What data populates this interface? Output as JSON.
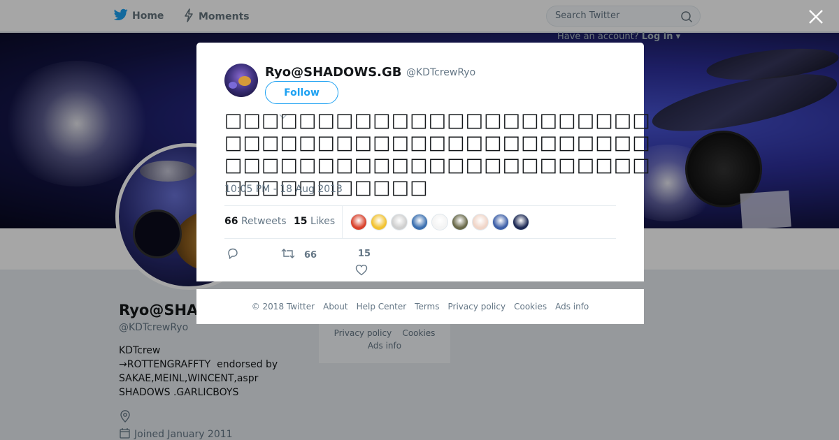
{
  "nav": {
    "home_label": "Home",
    "moments_label": "Moments",
    "search_placeholder": "Search Twitter",
    "have_account": "Have an account?",
    "login_label": "Log in"
  },
  "profile": {
    "name": "Ryo@SHA",
    "handle": "@KDTcrewRyo",
    "bio_lines": [
      "KDTcrew",
      "→ROTTENGRAFFTY  endorsed by",
      "SAKAE,MEINL,WINCENT,aspr",
      "SHADOWS .GARLICBOYS"
    ],
    "joined": "Joined January 2011"
  },
  "side_footer": {
    "row1": [
      "Privacy policy",
      "Cookies"
    ],
    "row2": "Ads info"
  },
  "tweet": {
    "author_name": "Ryo@SHADOWS.GB",
    "author_handle": "@KDTcrewRyo",
    "follow_label": "Follow",
    "text": "□□□□□□□□□□□□□□□□□□□□□□□□□□□□□□□□□□□□□□□□□□□□□□□□□□□□□□□□□□□□□□□□□□□□□□□□□□□□□□□□",
    "timestamp": "10:05 PM - 18 Aug 2013",
    "retweets_count": "66",
    "retweets_label": "Retweets",
    "likes_count": "15",
    "likes_label": "Likes",
    "action_retweet_count": "66",
    "action_like_count": "15",
    "liker_colors": [
      "#d9412b",
      "#f2c230",
      "#cfcfcf",
      "#3a6fb0",
      "#f4f4f4",
      "#6a6a4a",
      "#f0d5c8",
      "#3d5fa8",
      "#1e2a55"
    ]
  },
  "footer": {
    "copyright": "© 2018 Twitter",
    "about": "About",
    "help": "Help Center",
    "terms": "Terms",
    "privacy": "Privacy policy",
    "cookies": "Cookies",
    "ads": "Ads info"
  },
  "colors": {
    "accent": "#1da1f2",
    "text_secondary": "#657786"
  }
}
